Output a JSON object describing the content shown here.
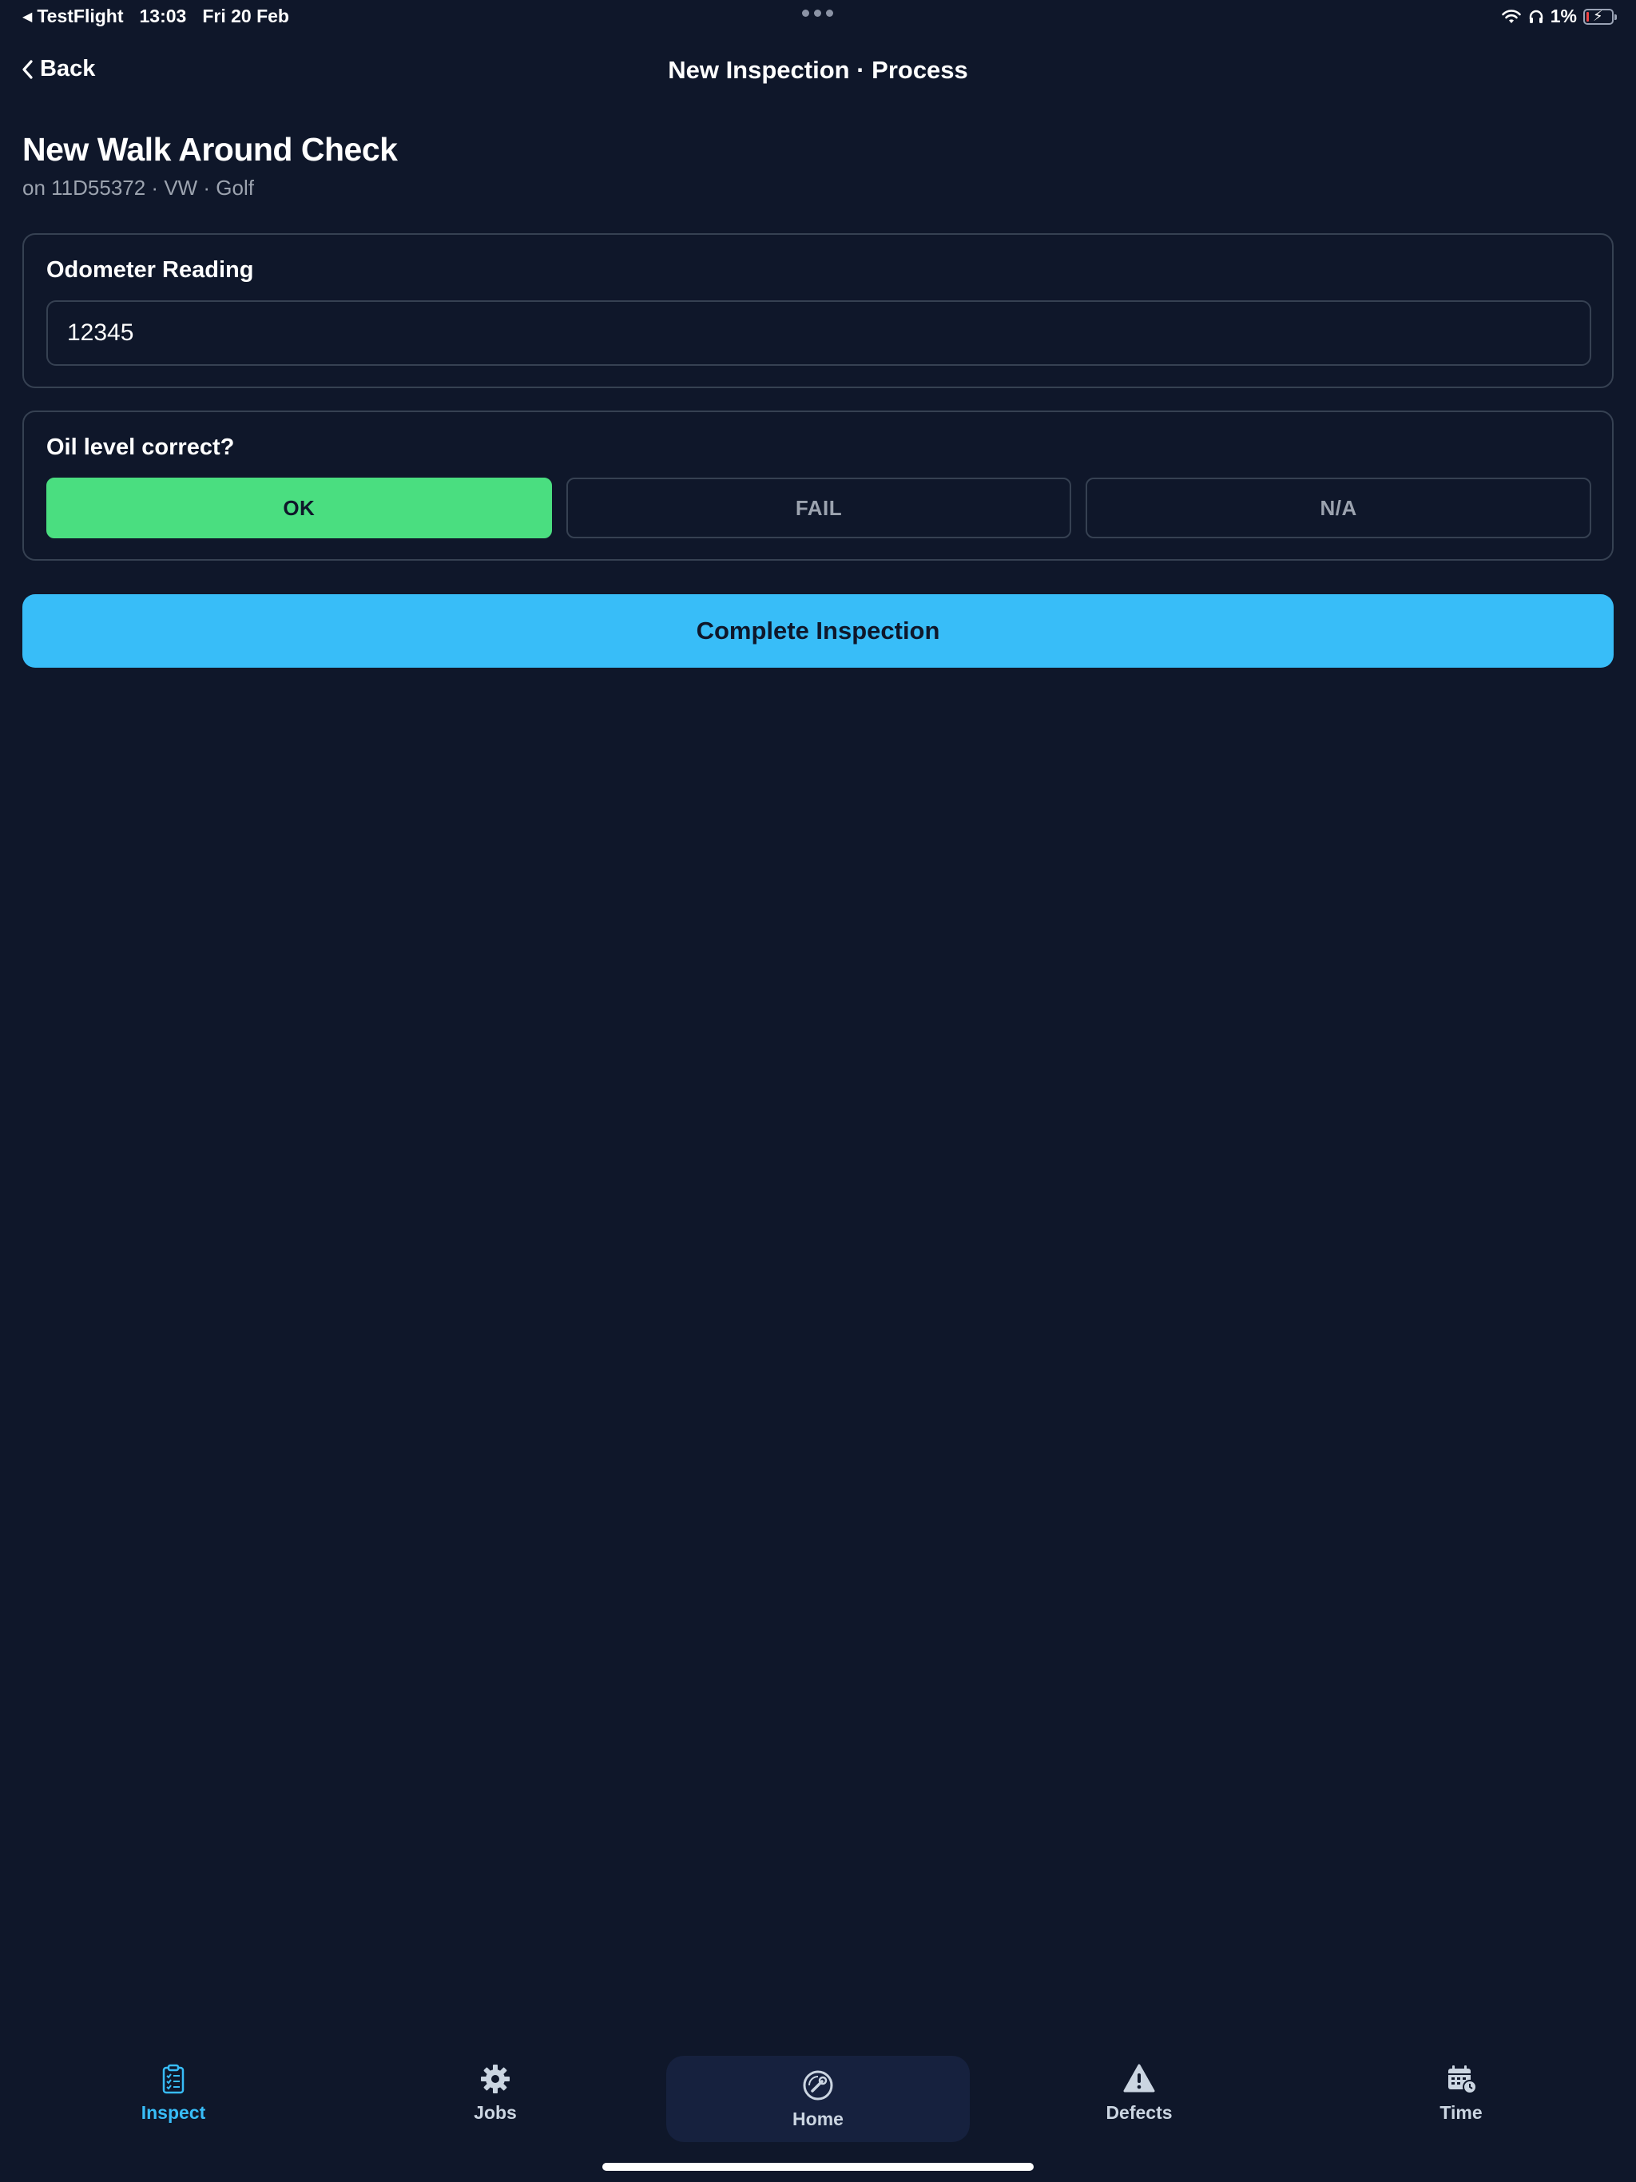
{
  "status_bar": {
    "back_app": "TestFlight",
    "time": "13:03",
    "date": "Fri 20 Feb",
    "battery_percent": "1%",
    "icons": [
      "wifi-icon",
      "headphones-icon",
      "battery-charging-icon"
    ],
    "battery_level": 0.01
  },
  "nav": {
    "back_label": "Back",
    "title": "New Inspection · Process"
  },
  "header": {
    "title": "New Walk Around Check",
    "subtitle": "on 11D55372 · VW · Golf"
  },
  "odometer": {
    "label": "Odometer Reading",
    "value": "12345"
  },
  "oil_check": {
    "label": "Oil level correct?",
    "options": [
      "OK",
      "FAIL",
      "N/A"
    ],
    "selected": "OK"
  },
  "complete_button": {
    "label": "Complete Inspection"
  },
  "tab_bar": {
    "items": [
      {
        "label": "Inspect",
        "icon": "clipboard-check-icon",
        "active": true
      },
      {
        "label": "Jobs",
        "icon": "gear-icon",
        "active": false
      },
      {
        "label": "Home",
        "icon": "wrench-circle-icon",
        "active": false
      },
      {
        "label": "Defects",
        "icon": "warning-icon",
        "active": false
      },
      {
        "label": "Time",
        "icon": "calendar-clock-icon",
        "active": false
      }
    ]
  },
  "colors": {
    "background": "#0f172a",
    "accent": "#38bdf8",
    "ok_green": "#4ade80",
    "border": "#364152",
    "muted_text": "#9ca3af"
  }
}
